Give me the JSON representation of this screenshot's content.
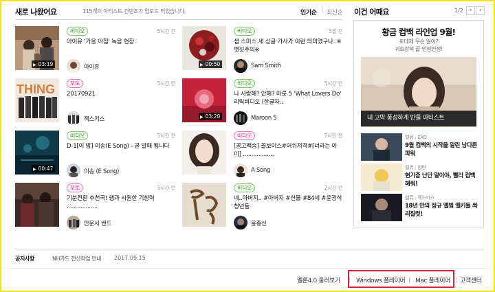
{
  "header": {
    "title": "새로 나왔어요",
    "subtitle": "115개의 아티스트 컨텐츠가 업로드 되었습니다.",
    "sort_popular": "인기순",
    "sort_latest": "최신순"
  },
  "cards": [
    {
      "badge": "비디오",
      "badge_type": "video",
      "time": "5시간 전",
      "title": "아이유 '가을 아침' 녹음 현장",
      "artist": "아이유",
      "duration": "03:19"
    },
    {
      "badge": "비디오",
      "badge_type": "video",
      "time": "5일 전",
      "title": "샘 스미스 새 싱글 가사가 이런 의미였구나..※뱃짓주의※",
      "artist": "Sam Smith",
      "duration": "00:50"
    },
    {
      "badge": "포토",
      "badge_type": "photo",
      "time": "5시간 전",
      "title": "20170921",
      "artist": "젝스키스",
      "duration": ""
    },
    {
      "badge": "비디오",
      "badge_type": "video",
      "time": "5시간 전",
      "title": "나 사랑해? 안해? 마룬 5 'What Lovers Do' 리릭비디오 (한글자..",
      "artist": "Maroon 5",
      "duration": "03:20"
    },
    {
      "badge": "비디오",
      "badge_type": "video",
      "time": "5시간 전",
      "title": "D-1[이 밤] 이송(E Song) - 곧 발매 됩니다",
      "artist": "이송 (E Song)",
      "duration": "00:47"
    },
    {
      "badge": "비디오",
      "badge_type": "video",
      "time": "5시간 전",
      "title": "[공고백송] 꼴보이스#어쉬저격#[너라는 아이] ..................",
      "artist": "A Song",
      "duration": ""
    },
    {
      "badge": "포토",
      "badge_type": "photo",
      "time": "5시간 전",
      "title": "기분전환 추천곡! 랩과 시원한 기창력 ..................",
      "artist": "만운서 밴드",
      "duration": ""
    },
    {
      "badge": "비디오",
      "badge_type": "video",
      "time": "2시간 전",
      "title": "네..아버지.. #아버지 #선물 #84세 #윤광석청년들",
      "artist": "윤종신",
      "duration": ""
    }
  ],
  "sidebar": {
    "title": "이건 어때요",
    "pager": "1/2",
    "prev_icon": "‹",
    "next_icon": "›",
    "promo_title": "황금 컴백 라인업 9월!",
    "promo_sub1": "토데체 무슨 일이?",
    "promo_sub2": "귀호강의 끝 인정인정!",
    "promo_caption": "내 고막 풍성하게 만들 아티스트",
    "items": [
      {
        "meta": "멜뮤 : EXO",
        "title": "9월 컴백의 시작을 알린 남다른 파워"
      },
      {
        "meta": "멜뮤 : 방탄",
        "title": "현기증 난단 말이야, 빨리 컴백해줘!"
      },
      {
        "meta": "멜뮤 : 젝스키스",
        "title": "18년 만의 정규 앨범 엘키들 쏴리질럿!"
      }
    ]
  },
  "notice": {
    "label": "공지사항",
    "text": "NH카드 전산작업 안내",
    "date": "2017.09.15"
  },
  "footer": {
    "melon4": "멜론4.0 둘러보기",
    "windows": "Windows 플레이어",
    "mac": "Mac 플레이어",
    "support": "고객센터"
  },
  "colors": {
    "frame": "#f2e600",
    "highlight": "#d9213b",
    "video_badge": "#3e9a2a",
    "photo_badge": "#d13c8a"
  }
}
